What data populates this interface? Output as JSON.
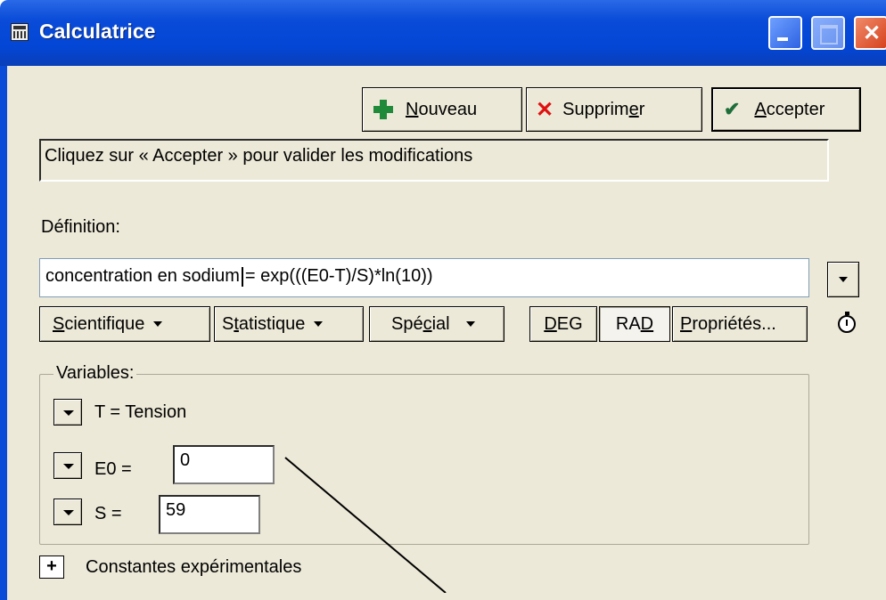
{
  "window": {
    "title": "Calculatrice"
  },
  "toolbar": {
    "new_label_u": "N",
    "new_label_rest": "ouveau",
    "delete_label_pre": "Supprim",
    "delete_label_u": "e",
    "delete_label_post": "r",
    "accept_label_u": "A",
    "accept_label_rest": "ccepter"
  },
  "message": "Cliquez sur « Accepter » pour valider les modifications",
  "definition": {
    "label": "Définition:",
    "formula_left": "concentration en sodium",
    "formula_right": "= exp(((E0-T)/S)*ln(10))"
  },
  "functions": {
    "scientific_u": "S",
    "scientific_rest": "cientifique",
    "statistic_pre": "S",
    "statistic_u": "t",
    "statistic_rest": "atistique",
    "special_pre": "Spé",
    "special_u": "c",
    "special_rest": "ial",
    "deg_u": "D",
    "deg_rest": "EG",
    "rad_pre": "RA",
    "rad_u": "D",
    "properties_u": "P",
    "properties_rest": "ropriétés..."
  },
  "variables": {
    "title": "Variables:",
    "t_label": "T = Tension",
    "e0_label": "E0 =",
    "e0_value": "0",
    "s_label": "S =",
    "s_value": "59"
  },
  "constants": {
    "label": "Constantes expérimentales"
  },
  "colors": {
    "titlebar": "#0a4cd8",
    "face": "#ece9d8",
    "accent_green": "#1f8a3a",
    "accent_red": "#e01010"
  }
}
